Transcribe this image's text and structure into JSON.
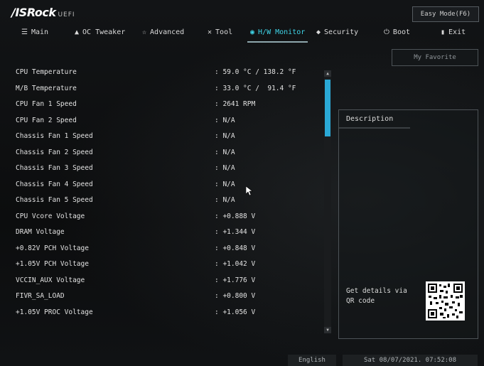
{
  "app": {
    "logo": "/ISRock",
    "logo_suffix": "UEFI",
    "easy_mode": "Easy Mode(F6)"
  },
  "nav": {
    "tabs": [
      {
        "label": "Main",
        "icon": "menu-icon"
      },
      {
        "label": "OC Tweaker",
        "icon": "rocket-icon"
      },
      {
        "label": "Advanced",
        "icon": "star-icon"
      },
      {
        "label": "Tool",
        "icon": "tools-icon"
      },
      {
        "label": "H/W Monitor",
        "icon": "monitor-icon",
        "active": true
      },
      {
        "label": "Security",
        "icon": "shield-icon"
      },
      {
        "label": "Boot",
        "icon": "power-icon"
      },
      {
        "label": "Exit",
        "icon": "exit-icon"
      }
    ]
  },
  "favorite": "My Favorite",
  "monitor": {
    "rows": [
      {
        "label": "CPU Temperature",
        "value": ": 59.0 °C / 138.2 °F"
      },
      {
        "label": "M/B Temperature",
        "value": ": 33.0 °C /  91.4 °F"
      },
      {
        "label": "CPU Fan 1 Speed",
        "value": ": 2641 RPM"
      },
      {
        "label": "CPU Fan 2 Speed",
        "value": ": N/A"
      },
      {
        "label": "Chassis Fan 1 Speed",
        "value": ": N/A"
      },
      {
        "label": "Chassis Fan 2 Speed",
        "value": ": N/A"
      },
      {
        "label": "Chassis Fan 3 Speed",
        "value": ": N/A"
      },
      {
        "label": "Chassis Fan 4 Speed",
        "value": ": N/A"
      },
      {
        "label": "Chassis Fan 5 Speed",
        "value": ": N/A"
      },
      {
        "label": "CPU Vcore Voltage",
        "value": ": +0.888 V"
      },
      {
        "label": "DRAM Voltage",
        "value": ": +1.344 V"
      },
      {
        "label": "+0.82V PCH Voltage",
        "value": ": +0.848 V"
      },
      {
        "label": "+1.05V PCH Voltage",
        "value": ": +1.042 V"
      },
      {
        "label": "VCCIN_AUX Voltage",
        "value": ": +1.776 V"
      },
      {
        "label": "FIVR_SA_LOAD",
        "value": ": +0.800 V"
      },
      {
        "label": "+1.05V PROC Voltage",
        "value": ": +1.056 V"
      }
    ]
  },
  "description": {
    "title": "Description",
    "qr_text": "Get details via QR code"
  },
  "status": {
    "language": "English",
    "datetime": "Sat 08/07/2021. 07:52:08"
  },
  "colors": {
    "accent": "#3fd5e8",
    "scroll_thumb": "#2aa9d6"
  }
}
